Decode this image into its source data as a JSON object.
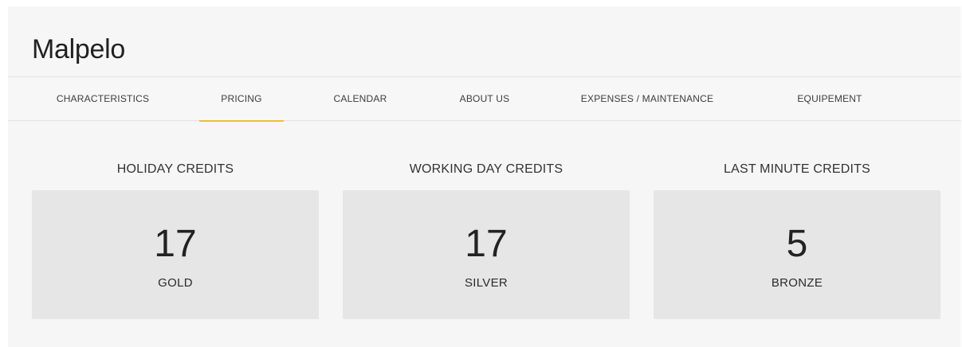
{
  "page": {
    "title": "Malpelo"
  },
  "tabs": [
    {
      "label": "CHARACTERISTICS",
      "active": false
    },
    {
      "label": "PRICING",
      "active": true
    },
    {
      "label": "CALENDAR",
      "active": false
    },
    {
      "label": "ABOUT US",
      "active": false
    },
    {
      "label": "EXPENSES / MAINTENANCE",
      "active": false
    },
    {
      "label": "EQUIPEMENT",
      "active": false
    }
  ],
  "credits": [
    {
      "heading": "HOLIDAY CREDITS",
      "value": "17",
      "tier": "GOLD"
    },
    {
      "heading": "WORKING DAY CREDITS",
      "value": "17",
      "tier": "SILVER"
    },
    {
      "heading": "LAST MINUTE CREDITS",
      "value": "5",
      "tier": "BRONZE"
    }
  ],
  "colors": {
    "accent": "#e8bf3a",
    "panel_background": "#f6f6f6",
    "card_background": "#e6e6e6"
  }
}
